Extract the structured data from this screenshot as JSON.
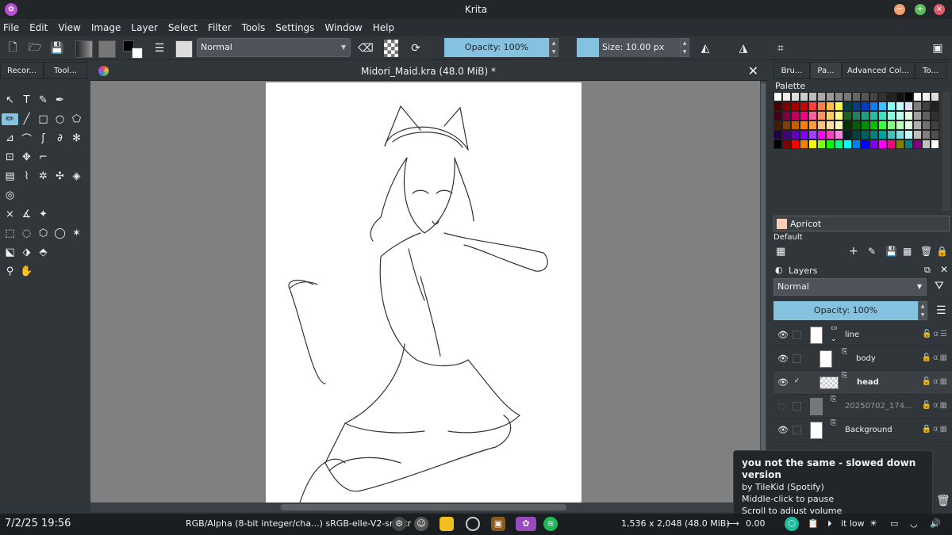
{
  "window": {
    "title": "Krita",
    "app_icon": "krita-icon"
  },
  "menu": [
    "File",
    "Edit",
    "View",
    "Image",
    "Layer",
    "Select",
    "Filter",
    "Tools",
    "Settings",
    "Window",
    "Help"
  ],
  "toolbar": {
    "blend_mode": "Normal",
    "opacity_label": "Opacity: 100%",
    "size_label": "Size: 10.00 px"
  },
  "left_docker": {
    "tabs": [
      "Recor...",
      "Tool..."
    ]
  },
  "document": {
    "tab_title": "Midori_Maid.kra (48.0 MiB) *"
  },
  "right_docker": {
    "tabs": [
      "Bru...",
      "Pa...",
      "Advanced Col...",
      "To..."
    ],
    "palette_title": "Palette",
    "selected_color": "Apricot",
    "selected_color_hex": "#fbceb1",
    "palette_name": "Default"
  },
  "layers_panel": {
    "title": "Layers",
    "blend_mode": "Normal",
    "opacity_label": "Opacity:  100%",
    "layers": [
      {
        "name": "line",
        "visible": true,
        "selected": false,
        "type": "group"
      },
      {
        "name": "body",
        "visible": true,
        "selected": false,
        "type": "paint"
      },
      {
        "name": "head",
        "visible": true,
        "selected": true,
        "type": "paint"
      },
      {
        "name": "20250702_174...",
        "visible": false,
        "selected": false,
        "type": "paint"
      },
      {
        "name": "Background",
        "visible": true,
        "selected": false,
        "type": "paint",
        "locked": true
      }
    ]
  },
  "notification": {
    "title": "you not the same - slowed down version",
    "line1": "by TileKid (Spotify)",
    "line2": "Middle-click to pause",
    "line3": "Scroll to adjust volume"
  },
  "statusbar": {
    "datetime": "7/2/25 19:56",
    "color_space": "RGB/Alpha (8-bit integer/cha...)  sRGB-elle-V2-srgbtr",
    "image_size": "1,536 x 2,048 (48.0 MiB)",
    "rotation": "0.00",
    "extra": "it low"
  }
}
